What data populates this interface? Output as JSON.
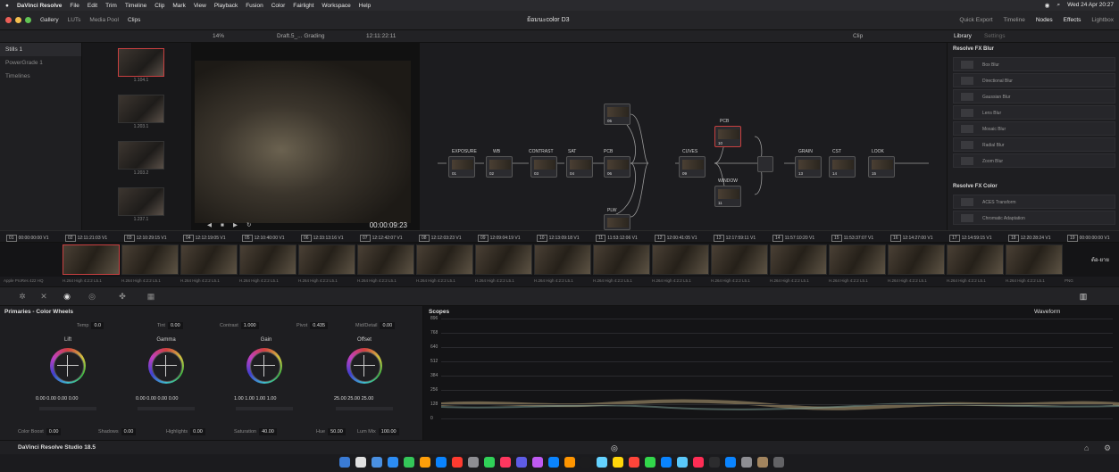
{
  "macbar": {
    "menus": [
      "DaVinci Resolve",
      "File",
      "Edit",
      "Trim",
      "Timeline",
      "Clip",
      "Mark",
      "View",
      "Playback",
      "Fusion",
      "Color",
      "Fairlight",
      "Workspace",
      "Help"
    ],
    "datetime": "Wed 24 Apr  20:27"
  },
  "toolbar": {
    "left_items": [
      "Gallery",
      "LUTs",
      "Media Pool",
      "Clips"
    ],
    "project_title": "ย้อมนะcolor D3",
    "right_items": [
      "Quick Export",
      "Timeline",
      "Nodes",
      "Effects",
      "Lightbox"
    ]
  },
  "subbar": {
    "zoom": "14%",
    "timeline_name": "Draft.5_... Grading",
    "timecode": "12:11:22:11",
    "clip_menu": "Clip",
    "library_tab": "Library",
    "settings_tab": "Settings"
  },
  "leftpanel": {
    "items": [
      "Stills 1",
      "PowerGrade 1",
      "Timelines"
    ]
  },
  "stills": {
    "labels": [
      "1.104.1",
      "1.203.1",
      "1.203.2",
      "1.237.1"
    ]
  },
  "viewer": {
    "timecode": "00:00:09:23"
  },
  "nodes": {
    "labels": [
      "EXPOSURE",
      "WB",
      "CONTRAST",
      "SAT",
      "PCB",
      "CUVES",
      "PCB",
      "WINDOW",
      "GRAIN",
      "CST",
      "LOOK",
      "PLW"
    ],
    "numbers": [
      "01",
      "02",
      "03",
      "04",
      "05",
      "09",
      "10",
      "11",
      "13",
      "14",
      "15",
      "12",
      "06"
    ]
  },
  "library": {
    "blur_header": "Resolve FX Blur",
    "blur_items": [
      "Box Blur",
      "Directional Blur",
      "Gaussian Blur",
      "Lens Blur",
      "Mosaic Blur",
      "Radial Blur",
      "Zoom Blur"
    ],
    "color_header": "Resolve FX Color",
    "color_items": [
      "ACES Transform",
      "Chromatic Adaptation"
    ]
  },
  "clips": [
    {
      "n": "01",
      "tc": "00:00:00:00"
    },
    {
      "n": "02",
      "tc": "12:11:21:03"
    },
    {
      "n": "03",
      "tc": "12:10:29:15"
    },
    {
      "n": "04",
      "tc": "12:12:19:05"
    },
    {
      "n": "05",
      "tc": "12:10:40:00"
    },
    {
      "n": "06",
      "tc": "12:33:13:16"
    },
    {
      "n": "07",
      "tc": "12:12:42:07"
    },
    {
      "n": "08",
      "tc": "12:12:03:23"
    },
    {
      "n": "09",
      "tc": "12:09:04:19"
    },
    {
      "n": "10",
      "tc": "12:13:09:18"
    },
    {
      "n": "11",
      "tc": "11:53:12:06"
    },
    {
      "n": "12",
      "tc": "12:00:41:05"
    },
    {
      "n": "13",
      "tc": "12:17:59:11"
    },
    {
      "n": "14",
      "tc": "11:57:10:20"
    },
    {
      "n": "15",
      "tc": "11:53:37:07"
    },
    {
      "n": "16",
      "tc": "12:14:27:00"
    },
    {
      "n": "17",
      "tc": "12:14:59:15"
    },
    {
      "n": "18",
      "tc": "12:20:28:24"
    },
    {
      "n": "19",
      "tc": "00:00:00:00"
    }
  ],
  "clip_track": "V1",
  "codecs": {
    "first": "Apple ProRes 422 HQ",
    "repeat": "H.264 High 4:2:2 L5.1",
    "last": "PNG",
    "end_clip_text": "ต้อ-ยาย"
  },
  "primaries": {
    "title": "Primaries - Color Wheels",
    "temp": {
      "label": "Temp",
      "value": "0.0"
    },
    "tint": {
      "label": "Tint",
      "value": "0.00"
    },
    "contrast": {
      "label": "Contrast",
      "value": "1.000"
    },
    "pivot": {
      "label": "Pivot",
      "value": "0.435"
    },
    "middetail": {
      "label": "Mid/Detail",
      "value": "0.00"
    },
    "wheels": [
      {
        "name": "Lift",
        "values": "0.00  0.00  0.00  0.00"
      },
      {
        "name": "Gamma",
        "values": "0.00  0.00  0.00  0.00"
      },
      {
        "name": "Gain",
        "values": "1.00  1.00  1.00  1.00"
      },
      {
        "name": "Offset",
        "values": "25.00  25.00  25.00"
      }
    ],
    "colorboost": {
      "label": "Color Boost",
      "value": "0.00"
    },
    "shadows": {
      "label": "Shadows",
      "value": "0.00"
    },
    "highlights": {
      "label": "Highlights",
      "value": "0.00"
    },
    "saturation": {
      "label": "Saturation",
      "value": "40.00"
    },
    "hue": {
      "label": "Hue",
      "value": "50.00"
    },
    "lummix": {
      "label": "Lum Mix",
      "value": "100.00"
    }
  },
  "scopes": {
    "title": "Scopes",
    "mode": "Waveform",
    "ticks": [
      "896",
      "768",
      "640",
      "512",
      "384",
      "256",
      "128",
      "0"
    ]
  },
  "bottom": {
    "brand": "DaVinci Resolve Studio 18.5"
  },
  "colors": {
    "accent_red": "#c94040",
    "bg": "#1b1b1e"
  }
}
